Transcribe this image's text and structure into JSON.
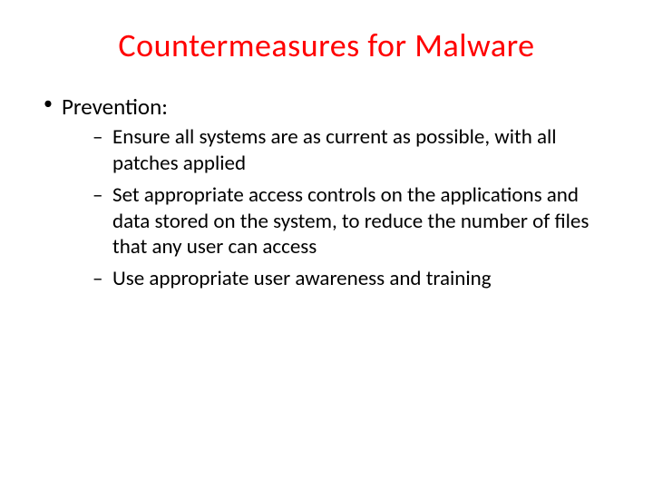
{
  "title": "Countermeasures for Malware",
  "bullets": [
    {
      "text": "Prevention:",
      "subitems": [
        "Ensure all systems are as current as possible, with all patches applied",
        "Set appropriate access controls on the applications and data stored on the system, to reduce the number of files that any user can access",
        "Use appropriate user awareness and training"
      ]
    }
  ]
}
